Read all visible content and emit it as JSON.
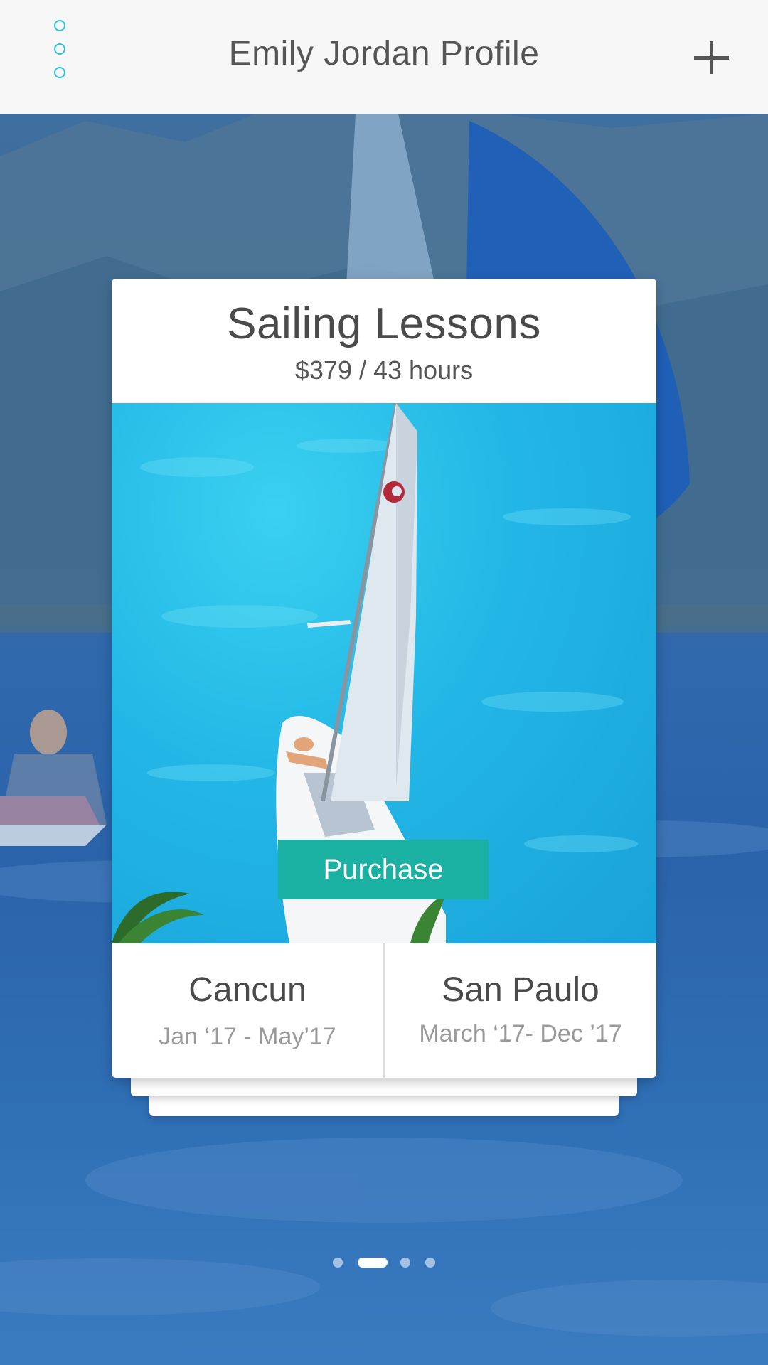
{
  "header": {
    "title": "Emily Jordan Profile",
    "menu_icon": "vertical-dots-icon",
    "add_icon": "plus-icon"
  },
  "card": {
    "title": "Sailing Lessons",
    "subtitle": "$379 / 43 hours",
    "purchase_label": "Purchase",
    "locations": [
      {
        "name": "Cancun",
        "dates": "Jan ‘17 - May’17"
      },
      {
        "name": "San Paulo",
        "dates": "March ‘17- Dec ’17"
      }
    ]
  },
  "pager": {
    "pages": 4,
    "active_index": 1
  },
  "colors": {
    "accent": "#2ec3dc",
    "purchase": "#1ab0a2",
    "topbar": "#f7f7f7",
    "background_tint": "#2b63aa"
  }
}
